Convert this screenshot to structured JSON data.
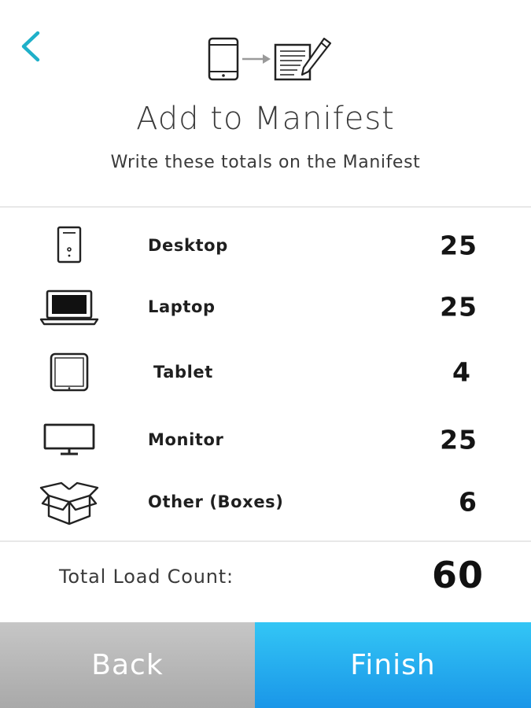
{
  "header": {
    "back_icon": "chevron-left-icon",
    "hero_icon": "phone-to-manifest-icon",
    "title": "Add to Manifest",
    "subtitle": "Write these totals on the Manifest"
  },
  "items": [
    {
      "icon": "desktop-tower-icon",
      "label": "Desktop",
      "count": "25"
    },
    {
      "icon": "laptop-icon",
      "label": "Laptop",
      "count": "25"
    },
    {
      "icon": "tablet-icon",
      "label": "Tablet",
      "count": "4"
    },
    {
      "icon": "monitor-icon",
      "label": "Monitor",
      "count": "25"
    },
    {
      "icon": "box-icon",
      "label": "Other (Boxes)",
      "count": "6"
    }
  ],
  "total": {
    "label": "Total Load Count:",
    "value": "60"
  },
  "buttons": {
    "back": "Back",
    "finish": "Finish"
  },
  "colors": {
    "accent": "#1fb0c9",
    "finish": "#24aef0",
    "back": "#b8b8b8"
  }
}
